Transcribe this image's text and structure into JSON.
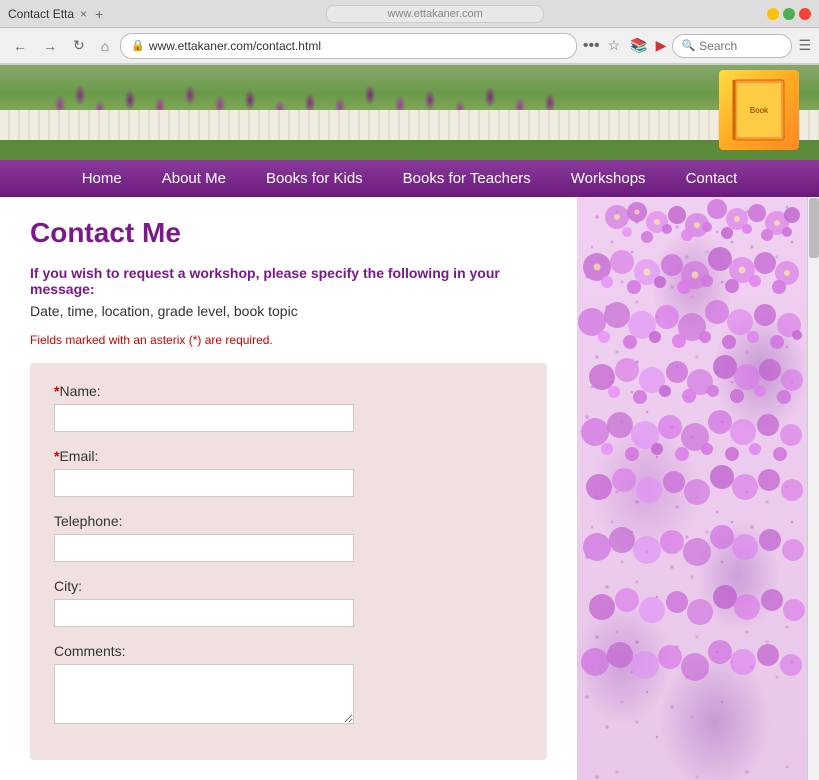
{
  "browser": {
    "tab_title": "Contact Etta",
    "tab_close": "×",
    "tab_add": "+",
    "nav_back": "←",
    "nav_forward": "→",
    "nav_refresh": "↻",
    "nav_home": "⌂",
    "address": "www.ettakaner.com/contact.html",
    "menu_dots": "•••",
    "search_placeholder": "Search"
  },
  "nav": {
    "items": [
      {
        "id": "home",
        "label": "Home"
      },
      {
        "id": "about-me",
        "label": "About Me"
      },
      {
        "id": "books-for-kids",
        "label": "Books for Kids"
      },
      {
        "id": "books-for-teachers",
        "label": "Books for Teachers"
      },
      {
        "id": "workshops",
        "label": "Workshops"
      },
      {
        "id": "contact",
        "label": "Contact"
      }
    ]
  },
  "page": {
    "title": "Contact Me",
    "workshop_notice": "If you wish to request a workshop, please specify the following in your message:",
    "workshop_detail": "Date, time, location, grade level, book topic",
    "required_notice": "Fields marked with an asterix (*) are required.",
    "form": {
      "fields": [
        {
          "id": "name",
          "label": "Name:",
          "required": true,
          "type": "text"
        },
        {
          "id": "email",
          "label": "Email:",
          "required": true,
          "type": "text"
        },
        {
          "id": "telephone",
          "label": "Telephone:",
          "required": false,
          "type": "text"
        },
        {
          "id": "city",
          "label": "City:",
          "required": false,
          "type": "text"
        },
        {
          "id": "comments",
          "label": "Comments:",
          "required": false,
          "type": "textarea"
        }
      ]
    }
  }
}
